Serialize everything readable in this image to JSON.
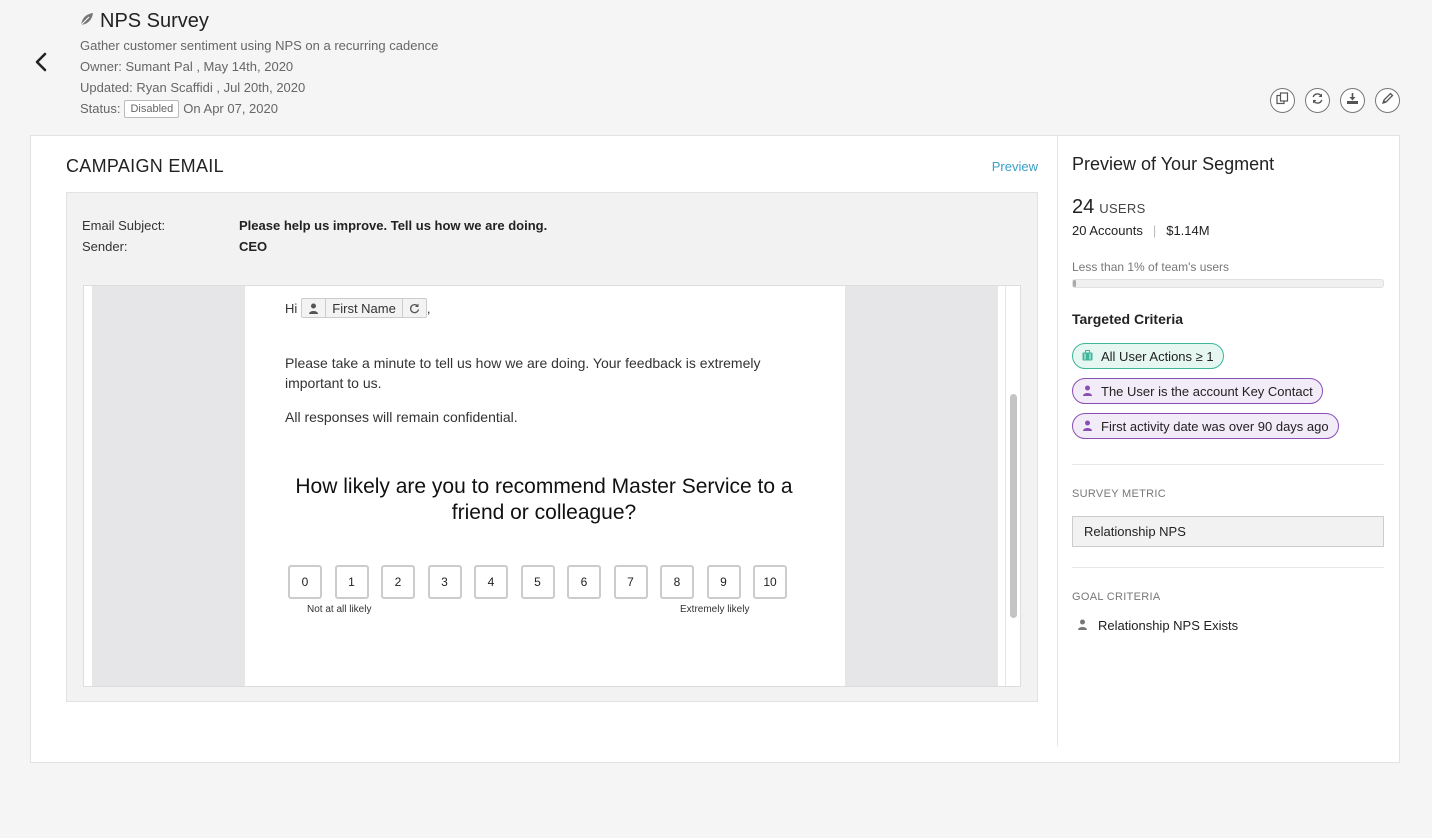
{
  "header": {
    "title": "NPS Survey",
    "description": "Gather customer sentiment using NPS on a recurring cadence",
    "owner": "Owner: Sumant Pal , May 14th, 2020",
    "updated": "Updated: Ryan Scaffidi , Jul 20th, 2020",
    "status_label": "Status:",
    "status_badge": "Disabled",
    "status_date": "On Apr 07, 2020"
  },
  "actions": {
    "icons": [
      "clone-icon",
      "refresh-icon",
      "download-icon",
      "edit-icon"
    ]
  },
  "campaign": {
    "section_title": "CAMPAIGN EMAIL",
    "preview_link": "Preview",
    "subject_label": "Email Subject:",
    "subject_value": "Please help us improve. Tell us how we are doing.",
    "sender_label": "Sender:",
    "sender_value": "CEO"
  },
  "email_body": {
    "greeting": "Hi",
    "merge_field": "First Name",
    "greeting_suffix": ",",
    "paragraph1": "Please take a minute to tell us how we are doing. Your feedback is extremely important to us.",
    "paragraph2": "All responses will remain confidential.",
    "question": "How likely are you to recommend Master Service to a friend or colleague?",
    "scale": [
      "0",
      "1",
      "2",
      "3",
      "4",
      "5",
      "6",
      "7",
      "8",
      "9",
      "10"
    ],
    "scale_low_label": "Not at all likely",
    "scale_high_label": "Extremely likely"
  },
  "segment": {
    "title": "Preview of Your Segment",
    "users_count": "24",
    "users_label": "USERS",
    "accounts": "20 Accounts",
    "arr": "$1.14M",
    "percent_label": "Less than 1% of team's users",
    "percent_fill": 0.01,
    "criteria_title": "Targeted Criteria",
    "criteria": [
      "All User Actions ≥ 1",
      "The User is the account Key Contact",
      "First activity date was over 90 days ago"
    ],
    "metric_title": "SURVEY METRIC",
    "metric_value": "Relationship NPS",
    "goal_title": "GOAL CRITERIA",
    "goal_value": "Relationship NPS Exists"
  },
  "colors": {
    "accent_link": "#3aa0c8",
    "chip_green": "#3db69a",
    "chip_purple": "#8a4fb4"
  }
}
